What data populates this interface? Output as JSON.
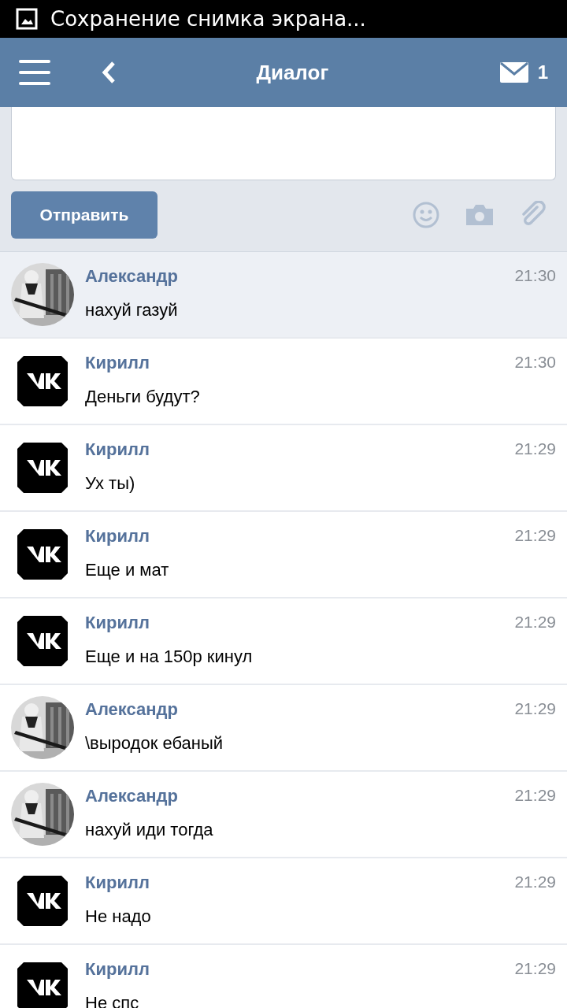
{
  "status_bar": {
    "notification": "Сохранение снимка экрана..."
  },
  "header": {
    "title": "Диалог",
    "mail_count": "1"
  },
  "composer": {
    "send_button": "Отправить"
  },
  "messages": [
    {
      "sender": "Александр",
      "text": "нахуй газуй",
      "time": "21:30",
      "unread": true
    },
    {
      "kind": "logo",
      "sender": "Кирилл",
      "text": "Деньги будут?",
      "time": "21:30",
      "unread": false
    },
    {
      "kind": "logo",
      "sender": "Кирилл",
      "text": "Ух ты)",
      "time": "21:29",
      "unread": false
    },
    {
      "kind": "logo",
      "sender": "Кирилл",
      "text": "Еще и мат",
      "time": "21:29",
      "unread": false
    },
    {
      "kind": "logo",
      "sender": "Кирилл",
      "text": "Еще и на 150р кинул",
      "time": "21:29",
      "unread": false
    },
    {
      "sender": "Александр",
      "text": "\\выродок ебаный",
      "time": "21:29",
      "unread": false
    },
    {
      "sender": "Александр",
      "text": "нахуй иди тогда",
      "time": "21:29",
      "unread": false
    },
    {
      "kind": "logo",
      "sender": "Кирилл",
      "text": "Не надо",
      "time": "21:29",
      "unread": false
    },
    {
      "kind": "logo",
      "sender": "Кирилл",
      "text": "Не спс",
      "time": "21:29",
      "unread": false
    }
  ]
}
